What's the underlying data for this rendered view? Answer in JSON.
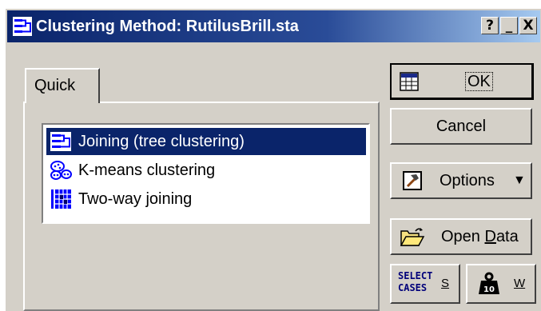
{
  "window": {
    "title": "Clustering Method: RutilusBrill.sta",
    "help_label": "?",
    "minimize_label": "_",
    "close_label": "X"
  },
  "tabs": [
    {
      "label": "Quick",
      "active": true
    }
  ],
  "methods": [
    {
      "label": "Joining (tree clustering)",
      "icon": "tree-clustering-icon",
      "selected": true
    },
    {
      "label": "K-means clustering",
      "icon": "kmeans-icon",
      "selected": false
    },
    {
      "label": "Two-way joining",
      "icon": "two-way-joining-icon",
      "selected": false
    }
  ],
  "buttons": {
    "ok": "OK",
    "cancel": "Cancel",
    "options": "Options",
    "open_data_prefix": "Open ",
    "open_data_underlined": "D",
    "open_data_suffix": "ata",
    "select_cases_line1": "SELECT",
    "select_cases_line2": "CASES",
    "select_cases_key": "S",
    "weight_key": "W",
    "weight_icon_number": "10"
  },
  "colors": {
    "title_active": "#0a246a",
    "selection": "#0a246a",
    "face": "#d4d0c8"
  }
}
